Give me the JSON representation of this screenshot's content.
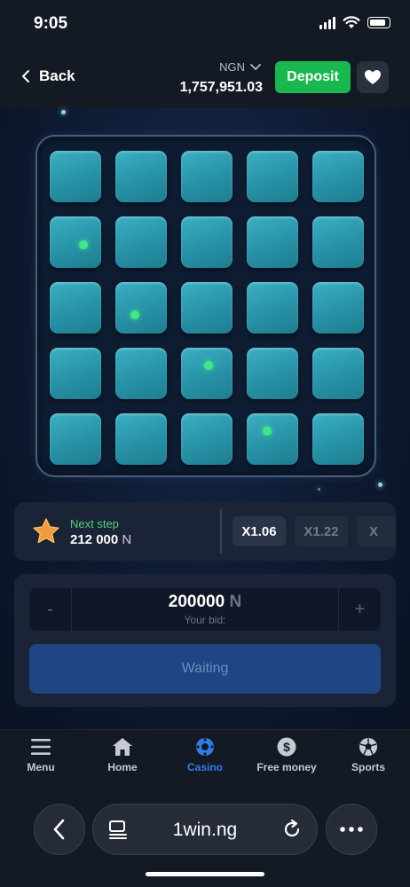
{
  "status_bar": {
    "time": "9:05"
  },
  "header": {
    "back_label": "Back",
    "currency": "NGN",
    "balance": "1,757,951.03",
    "deposit_label": "Deposit"
  },
  "board": {
    "rows": 5,
    "cols": 5,
    "marked_tiles": [
      [
        1,
        0
      ],
      [
        2,
        1
      ],
      [
        3,
        2
      ],
      [
        4,
        3
      ]
    ]
  },
  "step_panel": {
    "next_step_label": "Next step",
    "next_step_value": "212 000",
    "next_step_unit": "N",
    "multipliers": [
      "X1.06",
      "X1.22",
      "X"
    ]
  },
  "bet_panel": {
    "minus": "-",
    "plus": "+",
    "bid_value": "200000",
    "bid_unit": "N",
    "bid_label": "Your bid:",
    "waiting_label": "Waiting"
  },
  "tab_bar": {
    "items": [
      {
        "label": "Menu",
        "icon": "menu-icon"
      },
      {
        "label": "Home",
        "icon": "home-icon"
      },
      {
        "label": "Casino",
        "icon": "casino-icon",
        "active": true
      },
      {
        "label": "Free money",
        "icon": "dollar-icon"
      },
      {
        "label": "Sports",
        "icon": "soccer-ball-icon"
      }
    ],
    "active_color": "#2f7de8"
  },
  "browser": {
    "url": "1win.ng"
  },
  "colors": {
    "deposit": "#19b84e",
    "tile": "#2792a6",
    "marker": "#3ee885",
    "waiting_button": "#1f4585"
  }
}
